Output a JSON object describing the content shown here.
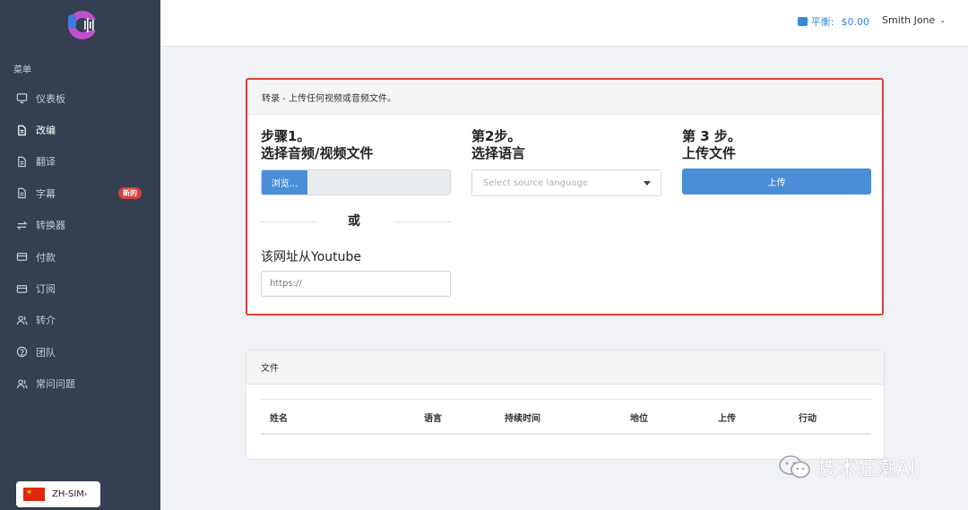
{
  "sidebar": {
    "menu_title": "菜单",
    "items": [
      {
        "label": "仪表板",
        "icon": "monitor-icon",
        "active": false
      },
      {
        "label": "改编",
        "icon": "document-icon",
        "active": true
      },
      {
        "label": "翻译",
        "icon": "document-icon",
        "active": false
      },
      {
        "label": "字幕",
        "icon": "document-icon",
        "active": false,
        "badge": "新的"
      },
      {
        "label": "转换器",
        "icon": "swap-icon",
        "active": false
      },
      {
        "label": "付款",
        "icon": "credit-card-icon",
        "active": false
      },
      {
        "label": "订阅",
        "icon": "credit-card-icon",
        "active": false
      },
      {
        "label": "转介",
        "icon": "users-icon",
        "active": false
      },
      {
        "label": "团队",
        "icon": "help-circle-icon",
        "active": false
      },
      {
        "label": "常问问题",
        "icon": "users-icon",
        "active": false
      }
    ],
    "language": "ZH-SIM"
  },
  "header": {
    "balance_label": "平衡:",
    "balance_amount": "$0.00",
    "user_name": "Smith Jone"
  },
  "upload": {
    "header": "转录 - 上传任何视频或音频文件。",
    "step1_line1": "步骤1。",
    "step1_line2": "选择音频/视频文件",
    "browse_label": "浏览...",
    "or_label": "或",
    "youtube_label": "该网址从Youtube",
    "youtube_placeholder": "https://",
    "step2_line1": "第2步。",
    "step2_line2": "选择语言",
    "language_placeholder": "Select source language",
    "step3_line1": "第 3 步。",
    "step3_line2": "上传文件",
    "upload_label": "上传"
  },
  "files": {
    "header": "文件",
    "columns": [
      "姓名",
      "语言",
      "持续时间",
      "地位",
      "上传",
      "行动"
    ]
  },
  "watermark": "技术狂潮AI",
  "colors": {
    "sidebar_bg": "#344052",
    "accent": "#4a8ed8",
    "highlight_border": "#e0403a",
    "badge": "#d9403a"
  }
}
